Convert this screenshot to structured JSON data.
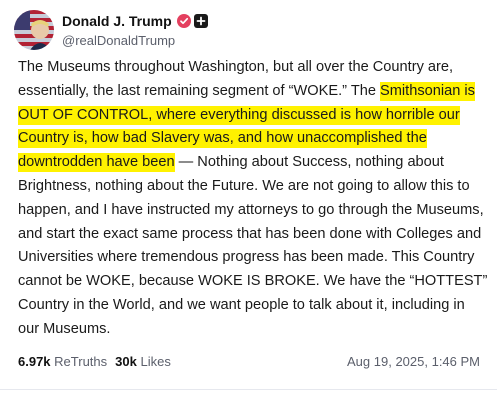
{
  "post": {
    "author": {
      "display_name": "Donald J. Trump",
      "handle": "@realDonaldTrump",
      "avatar_icon": "profile-photo",
      "verified_icon": "verified-check-icon",
      "affiliate_icon": "affiliate-badge-icon",
      "verified_color": "#e4405f"
    },
    "body": {
      "part1": "The Museums throughout Washington, but all over the Country are, essentially, the last remaining segment of “WOKE.” The ",
      "highlight": "Smithsonian is OUT OF CONTROL, where everything discussed is how horrible our Country is, how bad Slavery was, and how unaccomplished the downtrodden have been",
      "part2": " — Nothing about Success, nothing about Brightness, nothing about the Future. We are not going to allow this to happen, and I have instructed my attorneys to go through the Museums, and start the exact same process that has been done with Colleges and Universities where tremendous progress has been made. This Country cannot be WOKE, because WOKE IS BROKE. We have the “HOTTEST” Country in the World, and we want people to talk about it, including in our Museums."
    },
    "stats": {
      "retruths_count": "6.97k",
      "retruths_label": "ReTruths",
      "likes_count": "30k",
      "likes_label": "Likes"
    },
    "timestamp": "Aug 19, 2025, 1:46 PM",
    "highlight_color": "#fff200"
  }
}
